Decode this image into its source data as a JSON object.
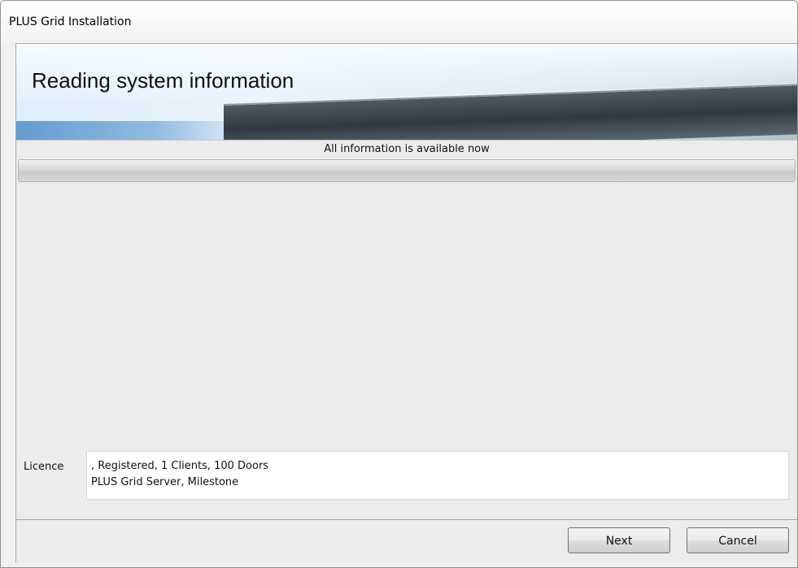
{
  "window": {
    "title": "PLUS Grid Installation"
  },
  "banner": {
    "heading": "Reading system information"
  },
  "status": {
    "text": "All information is available now",
    "progress_fraction": 1.0
  },
  "licence": {
    "label": "Licence",
    "line1": ", Registered, 1 Clients, 100 Doors",
    "line2": "PLUS Grid Server, Milestone"
  },
  "buttons": {
    "next_label": "Next",
    "cancel_label": "Cancel"
  }
}
